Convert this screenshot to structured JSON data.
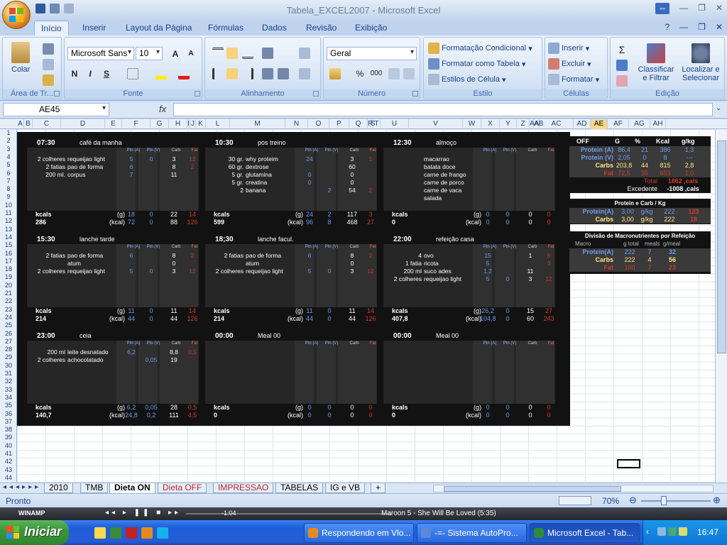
{
  "window": {
    "title": "Tabela_EXCEL2007 - Microsoft Excel"
  },
  "ribbon_tabs": [
    "Início",
    "Inserir",
    "Layout da Página",
    "Fórmulas",
    "Dados",
    "Revisão",
    "Exibição"
  ],
  "ribbon": {
    "clipboard": {
      "label": "Área de Tr...",
      "paste": "Colar"
    },
    "font": {
      "label": "Fonte",
      "name": "Microsoft Sans",
      "size": "10",
      "bold": "N",
      "italic": "I",
      "underline": "S"
    },
    "alignment": {
      "label": "Alinhamento"
    },
    "number": {
      "label": "Número",
      "format": "Geral",
      "percent": "%",
      "thousands": "000"
    },
    "styles": {
      "label": "Estilo",
      "cond": "Formatação Condicional",
      "table": "Formatar como Tabela",
      "cell": "Estilos de Célula"
    },
    "cells": {
      "label": "Células",
      "insert": "Inserir",
      "delete": "Excluir",
      "format": "Formatar"
    },
    "editing": {
      "label": "Edição",
      "sort": "Classificar e Filtrar",
      "find": "Localizar e Selecionar"
    }
  },
  "formula_bar": {
    "name_box": "AE45",
    "fx": "fx",
    "formula": ""
  },
  "columns": [
    "A",
    "B",
    "C",
    "D",
    "E",
    "F",
    "G",
    "H",
    "I",
    "J",
    "K",
    "L",
    "M",
    "N",
    "O",
    "P",
    "Q",
    "R",
    "S",
    "T",
    "U",
    "V",
    "W",
    "X",
    "Y",
    "Z",
    "AA",
    "AB",
    "AC",
    "AD",
    "AE",
    "AF",
    "AG",
    "AH",
    "AI"
  ],
  "selected_cell": {
    "column": "AE",
    "row": "45"
  },
  "meal_col_headers": {
    "pa": "Ptn (A)",
    "pv": "Ptn (V)",
    "carb": "Carb",
    "fat": "Fat"
  },
  "meals": [
    {
      "time": "07:30",
      "name": "café da manha",
      "items": [
        {
          "q": "2 colheres",
          "f": "requeijao light",
          "pa": "5",
          "pv": "0",
          "c": "3",
          "fat": "12"
        },
        {
          "q": "2 fatias",
          "f": "pao de forma",
          "pa": "6",
          "pv": "",
          "c": "8",
          "fat": "2"
        },
        {
          "q": "200 ml.",
          "f": "corpus",
          "pa": "7",
          "pv": "",
          "c": "11",
          "fat": ""
        }
      ],
      "kcal": "286",
      "g": {
        "pa": "18",
        "pv": "0",
        "c": "22",
        "fat": "14"
      },
      "k": {
        "pa": "72",
        "pv": "0",
        "c": "88",
        "fat": "126"
      }
    },
    {
      "time": "10:30",
      "name": "pos treino",
      "items": [
        {
          "q": "30 gr.",
          "f": "why proteim",
          "pa": "24",
          "pv": "",
          "c": "3",
          "fat": "1"
        },
        {
          "q": "60 gr.",
          "f": "dextrose",
          "pa": "",
          "pv": "",
          "c": "60",
          "fat": ""
        },
        {
          "q": "5 gr.",
          "f": "glutamina",
          "pa": "0",
          "pv": "",
          "c": "0",
          "fat": ""
        },
        {
          "q": "5 gr.",
          "f": "creatina",
          "pa": "0",
          "pv": "",
          "c": "0",
          "fat": ""
        },
        {
          "q": "2",
          "f": "banana",
          "pa": "",
          "pv": "2",
          "c": "54",
          "fat": "2"
        }
      ],
      "kcal": "599",
      "g": {
        "pa": "24",
        "pv": "2",
        "c": "117",
        "fat": "3"
      },
      "k": {
        "pa": "96",
        "pv": "8",
        "c": "468",
        "fat": "27"
      }
    },
    {
      "time": "12:30",
      "name": "almoço",
      "items": [
        {
          "q": "",
          "f": "macarrao",
          "pa": "",
          "pv": "",
          "c": "",
          "fat": ""
        },
        {
          "q": "",
          "f": "batata doce",
          "pa": "",
          "pv": "",
          "c": "",
          "fat": ""
        },
        {
          "q": "",
          "f": "carne de frango",
          "pa": "",
          "pv": "",
          "c": "",
          "fat": ""
        },
        {
          "q": "",
          "f": "carne de porco",
          "pa": "",
          "pv": "",
          "c": "",
          "fat": ""
        },
        {
          "q": "",
          "f": "carne de vaca",
          "pa": "",
          "pv": "",
          "c": "",
          "fat": ""
        },
        {
          "q": "",
          "f": "salada",
          "pa": "",
          "pv": "",
          "c": "",
          "fat": ""
        }
      ],
      "kcal": "0",
      "g": {
        "pa": "0",
        "pv": "0",
        "c": "0",
        "fat": "0"
      },
      "k": {
        "pa": "0",
        "pv": "0",
        "c": "0",
        "fat": "0"
      }
    },
    {
      "time": "15:30",
      "name": "lanche tarde",
      "items": [
        {
          "q": "2 fatias",
          "f": "pao de forma",
          "pa": "6",
          "pv": "",
          "c": "8",
          "fat": "2"
        },
        {
          "q": "",
          "f": "atum",
          "pa": "",
          "pv": "",
          "c": "0",
          "fat": ""
        },
        {
          "q": "2 colheres",
          "f": "requeijao light",
          "pa": "5",
          "pv": "0",
          "c": "3",
          "fat": "12"
        }
      ],
      "kcal": "214",
      "g": {
        "pa": "11",
        "pv": "0",
        "c": "11",
        "fat": "14"
      },
      "k": {
        "pa": "44",
        "pv": "0",
        "c": "44",
        "fat": "126"
      }
    },
    {
      "time": "18;30",
      "name": "lanche facul.",
      "items": [
        {
          "q": "2 fatias",
          "f": "pao de forma",
          "pa": "6",
          "pv": "",
          "c": "8",
          "fat": "2"
        },
        {
          "q": "",
          "f": "atum",
          "pa": "",
          "pv": "",
          "c": "0",
          "fat": ""
        },
        {
          "q": "2 colheres",
          "f": "requeijao light",
          "pa": "5",
          "pv": "0",
          "c": "3",
          "fat": "12"
        }
      ],
      "kcal": "214",
      "g": {
        "pa": "11",
        "pv": "0",
        "c": "11",
        "fat": "14"
      },
      "k": {
        "pa": "44",
        "pv": "0",
        "c": "44",
        "fat": "126"
      }
    },
    {
      "time": "22:00",
      "name": "refeição casa",
      "items": [
        {
          "q": "4",
          "f": "ovo",
          "pa": "15",
          "pv": "",
          "c": "1",
          "fat": "6"
        },
        {
          "q": "1 fatia",
          "f": "ricota",
          "pa": "5",
          "pv": "",
          "c": "",
          "fat": "3"
        },
        {
          "q": "200 ml",
          "f": "suco ades",
          "pa": "1,2",
          "pv": "",
          "c": "11",
          "fat": ""
        },
        {
          "q": "2 colheres",
          "f": "requeijao light",
          "pa": "5",
          "pv": "0",
          "c": "3",
          "fat": "12"
        }
      ],
      "kcal": "407,8",
      "g": {
        "pa": "26,2",
        "pv": "0",
        "c": "15",
        "fat": "27"
      },
      "k": {
        "pa": "104,8",
        "pv": "0",
        "c": "60",
        "fat": "243"
      }
    },
    {
      "time": "23:00",
      "name": "ceia",
      "items": [
        {
          "q": "200 ml",
          "f": "leite desnatado",
          "pa": "6,2",
          "pv": "",
          "c": "8,8",
          "fat": "0,5"
        },
        {
          "q": "2 colheres",
          "f": "achocolatado",
          "pa": "",
          "pv": "0,05",
          "c": "19",
          "fat": ""
        }
      ],
      "kcal": "140,7",
      "g": {
        "pa": "6,2",
        "pv": "0,05",
        "c": "28",
        "fat": "0,5"
      },
      "k": {
        "pa": "24,8",
        "pv": "0,2",
        "c": "111",
        "fat": "4,5"
      }
    },
    {
      "time": "00:00",
      "name": "Meal 00",
      "items": [],
      "kcal": "0",
      "g": {
        "pa": "0",
        "pv": "0",
        "c": "0",
        "fat": "0"
      },
      "k": {
        "pa": "0",
        "pv": "0",
        "c": "0",
        "fat": "0"
      }
    },
    {
      "time": "00:00",
      "name": "Meal 00",
      "items": [],
      "kcal": "0",
      "g": {
        "pa": "0",
        "pv": "0",
        "c": "0",
        "fat": "0"
      },
      "k": {
        "pa": "0",
        "pv": "0",
        "c": "0",
        "fat": "0"
      }
    }
  ],
  "meal_footer": {
    "kcals": "kcals",
    "g": "(g)",
    "kcal": "(kcal)"
  },
  "summary": {
    "header": [
      "OFF",
      "G",
      "%",
      "Kcal",
      "g/kg"
    ],
    "rows": [
      {
        "name": "Protein (A)",
        "g": "86,4",
        "pct": "21",
        "kcal": "386",
        "gkg": "1,3"
      },
      {
        "name": "Protein (V)",
        "g": "2,05",
        "pct": "0",
        "kcal": "8",
        "gkg": "---"
      },
      {
        "name": "Carbs",
        "g": "203,8",
        "pct": "44",
        "kcal": "815",
        "gkg": "2,8"
      },
      {
        "name": "Fat",
        "g": "72,5",
        "pct": "35",
        "kcal": "653",
        "gkg": "1,0"
      }
    ],
    "total_label": "Total",
    "total": "1862 ,cals",
    "excedente_label": "Excedente",
    "excedente": "-1008 ,cals"
  },
  "protein_carb": {
    "title": "Protein e Carb / Kg",
    "rows": [
      {
        "name": "Protein(A)",
        "v": "3,00",
        "u": "g/kg",
        "k": "222",
        "x": "123"
      },
      {
        "name": "Carbs",
        "v": "3,00",
        "u": "g/kg",
        "k": "222",
        "x": "18"
      }
    ]
  },
  "macro_div": {
    "title": "Divisão de Macronutrientes por Refeição",
    "header": [
      "Macro",
      "g total",
      "meals",
      "g/meal"
    ],
    "rows": [
      {
        "name": "Protein(A)",
        "t": "222",
        "m": "7",
        "gm": "32"
      },
      {
        "name": "Carbs",
        "t": "222",
        "m": "4",
        "gm": "56"
      },
      {
        "name": "Fat",
        "t": "160",
        "m": "7",
        "gm": "23"
      }
    ]
  },
  "sheets": [
    {
      "name": "2010",
      "style": "normal"
    },
    {
      "name": "TMB",
      "style": "normal"
    },
    {
      "name": "Dieta ON",
      "style": "active"
    },
    {
      "name": "Dieta OFF",
      "style": "red"
    },
    {
      "name": "IMPRESSAO",
      "style": "red"
    },
    {
      "name": "TABELAS",
      "style": "normal"
    },
    {
      "name": "IG e VB",
      "style": "normal"
    }
  ],
  "status": {
    "text": "Pronto",
    "zoom": "70%"
  },
  "winamp": {
    "label": "WINAMP",
    "time": "-1:04",
    "track": "Maroon 5 - She Will Be Loved (5:35)"
  },
  "taskbar": {
    "start": "Iniciar",
    "buttons": [
      "Respondendo em Vlo...",
      "-=- Sistema AutoPro...",
      "Microsoft Excel - Tab..."
    ],
    "clock": "16:47"
  },
  "colors": {
    "dark": "#121212",
    "panel": "#262626",
    "protein": "#6b9cf0",
    "fat": "#d23a2a",
    "carbs": "#ffe680",
    "accent": "#f8d68c"
  }
}
